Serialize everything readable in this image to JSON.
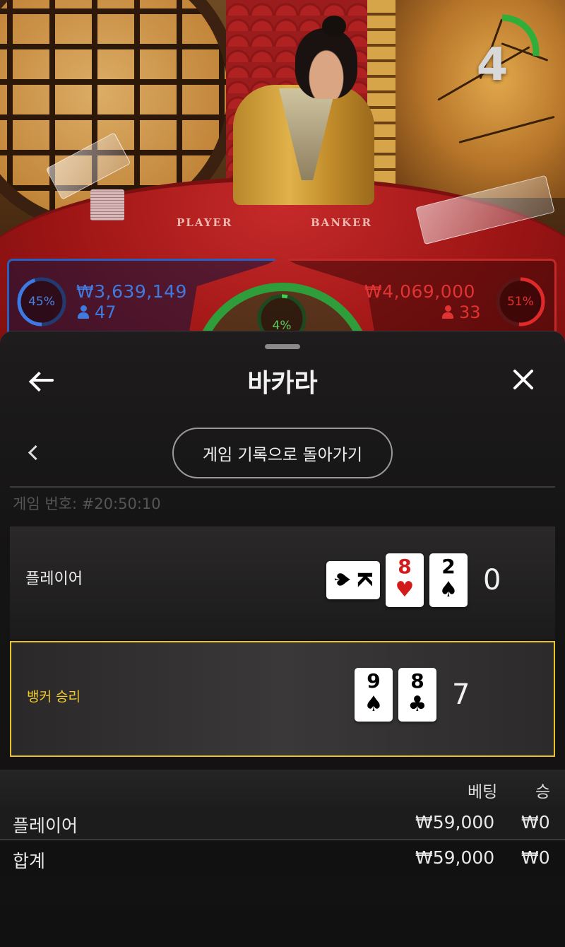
{
  "video": {
    "felt_left": "PLAYER",
    "felt_right": "BANKER",
    "timer": "4",
    "timer_progress": 0.27,
    "player_bets": {
      "percent": "45%",
      "percent_value": 45,
      "amount": "₩3,639,149",
      "count": "47",
      "color": "#2f6fd6"
    },
    "tie_bets": {
      "percent": "4%",
      "percent_value": 4,
      "color": "#2f9e3a"
    },
    "banker_bets": {
      "percent": "51%",
      "percent_value": 51,
      "amount": "₩4,069,000",
      "count": "33",
      "color": "#d32a2a"
    }
  },
  "sheet": {
    "title": "바카라",
    "back_button_icon": "arrow-left-icon",
    "close_button_icon": "close-icon",
    "history_button": "게임 기록으로 돌아가기",
    "game_number": "게임 번호: #20:50:10",
    "player": {
      "label": "플레이어",
      "cards": [
        {
          "rank": "K",
          "suit": "♠",
          "color": "black",
          "rotated": true
        },
        {
          "rank": "8",
          "suit": "♥",
          "color": "red",
          "rotated": false
        },
        {
          "rank": "2",
          "suit": "♠",
          "color": "black",
          "rotated": false
        }
      ],
      "score": "0"
    },
    "banker": {
      "label": "뱅커 승리",
      "cards": [
        {
          "rank": "9",
          "suit": "♠",
          "color": "black",
          "rotated": false
        },
        {
          "rank": "8",
          "suit": "♣",
          "color": "black",
          "rotated": false
        }
      ],
      "score": "7"
    },
    "table": {
      "headers": {
        "bet": "베팅",
        "win": "승"
      },
      "rows": [
        {
          "name": "플레이어",
          "bet": "₩59,000",
          "win": "₩0"
        },
        {
          "name": "합계",
          "bet": "₩59,000",
          "win": "₩0"
        }
      ]
    },
    "accent_color": "#e6c22c"
  }
}
